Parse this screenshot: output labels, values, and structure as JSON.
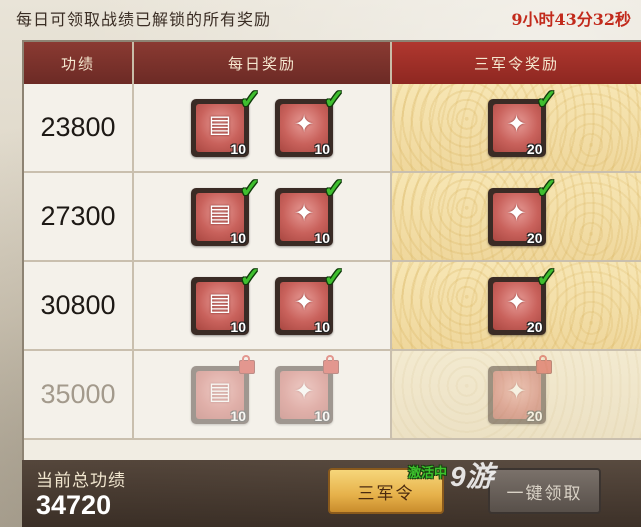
{
  "top": {
    "notice": "每日可领取战绩已解锁的所有奖励",
    "timer": "9小时43分32秒"
  },
  "table": {
    "headers": [
      "功绩",
      "每日奖励",
      "三军令奖励"
    ],
    "rows": [
      {
        "points": "23800",
        "daily": [
          {
            "count": "10",
            "claimed": true,
            "icon": "scroll-pile-icon"
          },
          {
            "count": "10",
            "claimed": true,
            "icon": "emblem-icon"
          }
        ],
        "army": [
          {
            "count": "20",
            "claimed": true,
            "icon": "emblem-icon"
          }
        ]
      },
      {
        "points": "27300",
        "daily": [
          {
            "count": "10",
            "claimed": true,
            "icon": "scroll-pile-icon"
          },
          {
            "count": "10",
            "claimed": true,
            "icon": "emblem-icon"
          }
        ],
        "army": [
          {
            "count": "20",
            "claimed": true,
            "icon": "emblem-icon"
          }
        ]
      },
      {
        "points": "30800",
        "daily": [
          {
            "count": "10",
            "claimed": true,
            "icon": "scroll-pile-icon"
          },
          {
            "count": "10",
            "claimed": true,
            "icon": "emblem-icon"
          }
        ],
        "army": [
          {
            "count": "20",
            "claimed": true,
            "icon": "emblem-icon"
          }
        ]
      },
      {
        "points": "35000",
        "locked": true,
        "daily": [
          {
            "count": "10",
            "claimed": false,
            "icon": "scroll-pile-icon"
          },
          {
            "count": "10",
            "claimed": false,
            "icon": "emblem-icon"
          }
        ],
        "army": [
          {
            "count": "20",
            "claimed": false,
            "icon": "emblem-icon"
          }
        ]
      }
    ]
  },
  "bottom": {
    "total_label": "当前总功绩",
    "total_value": "34720",
    "army_button": "三军令",
    "army_status": "激活中",
    "claim_button": "一键领取"
  },
  "watermark": "9游"
}
